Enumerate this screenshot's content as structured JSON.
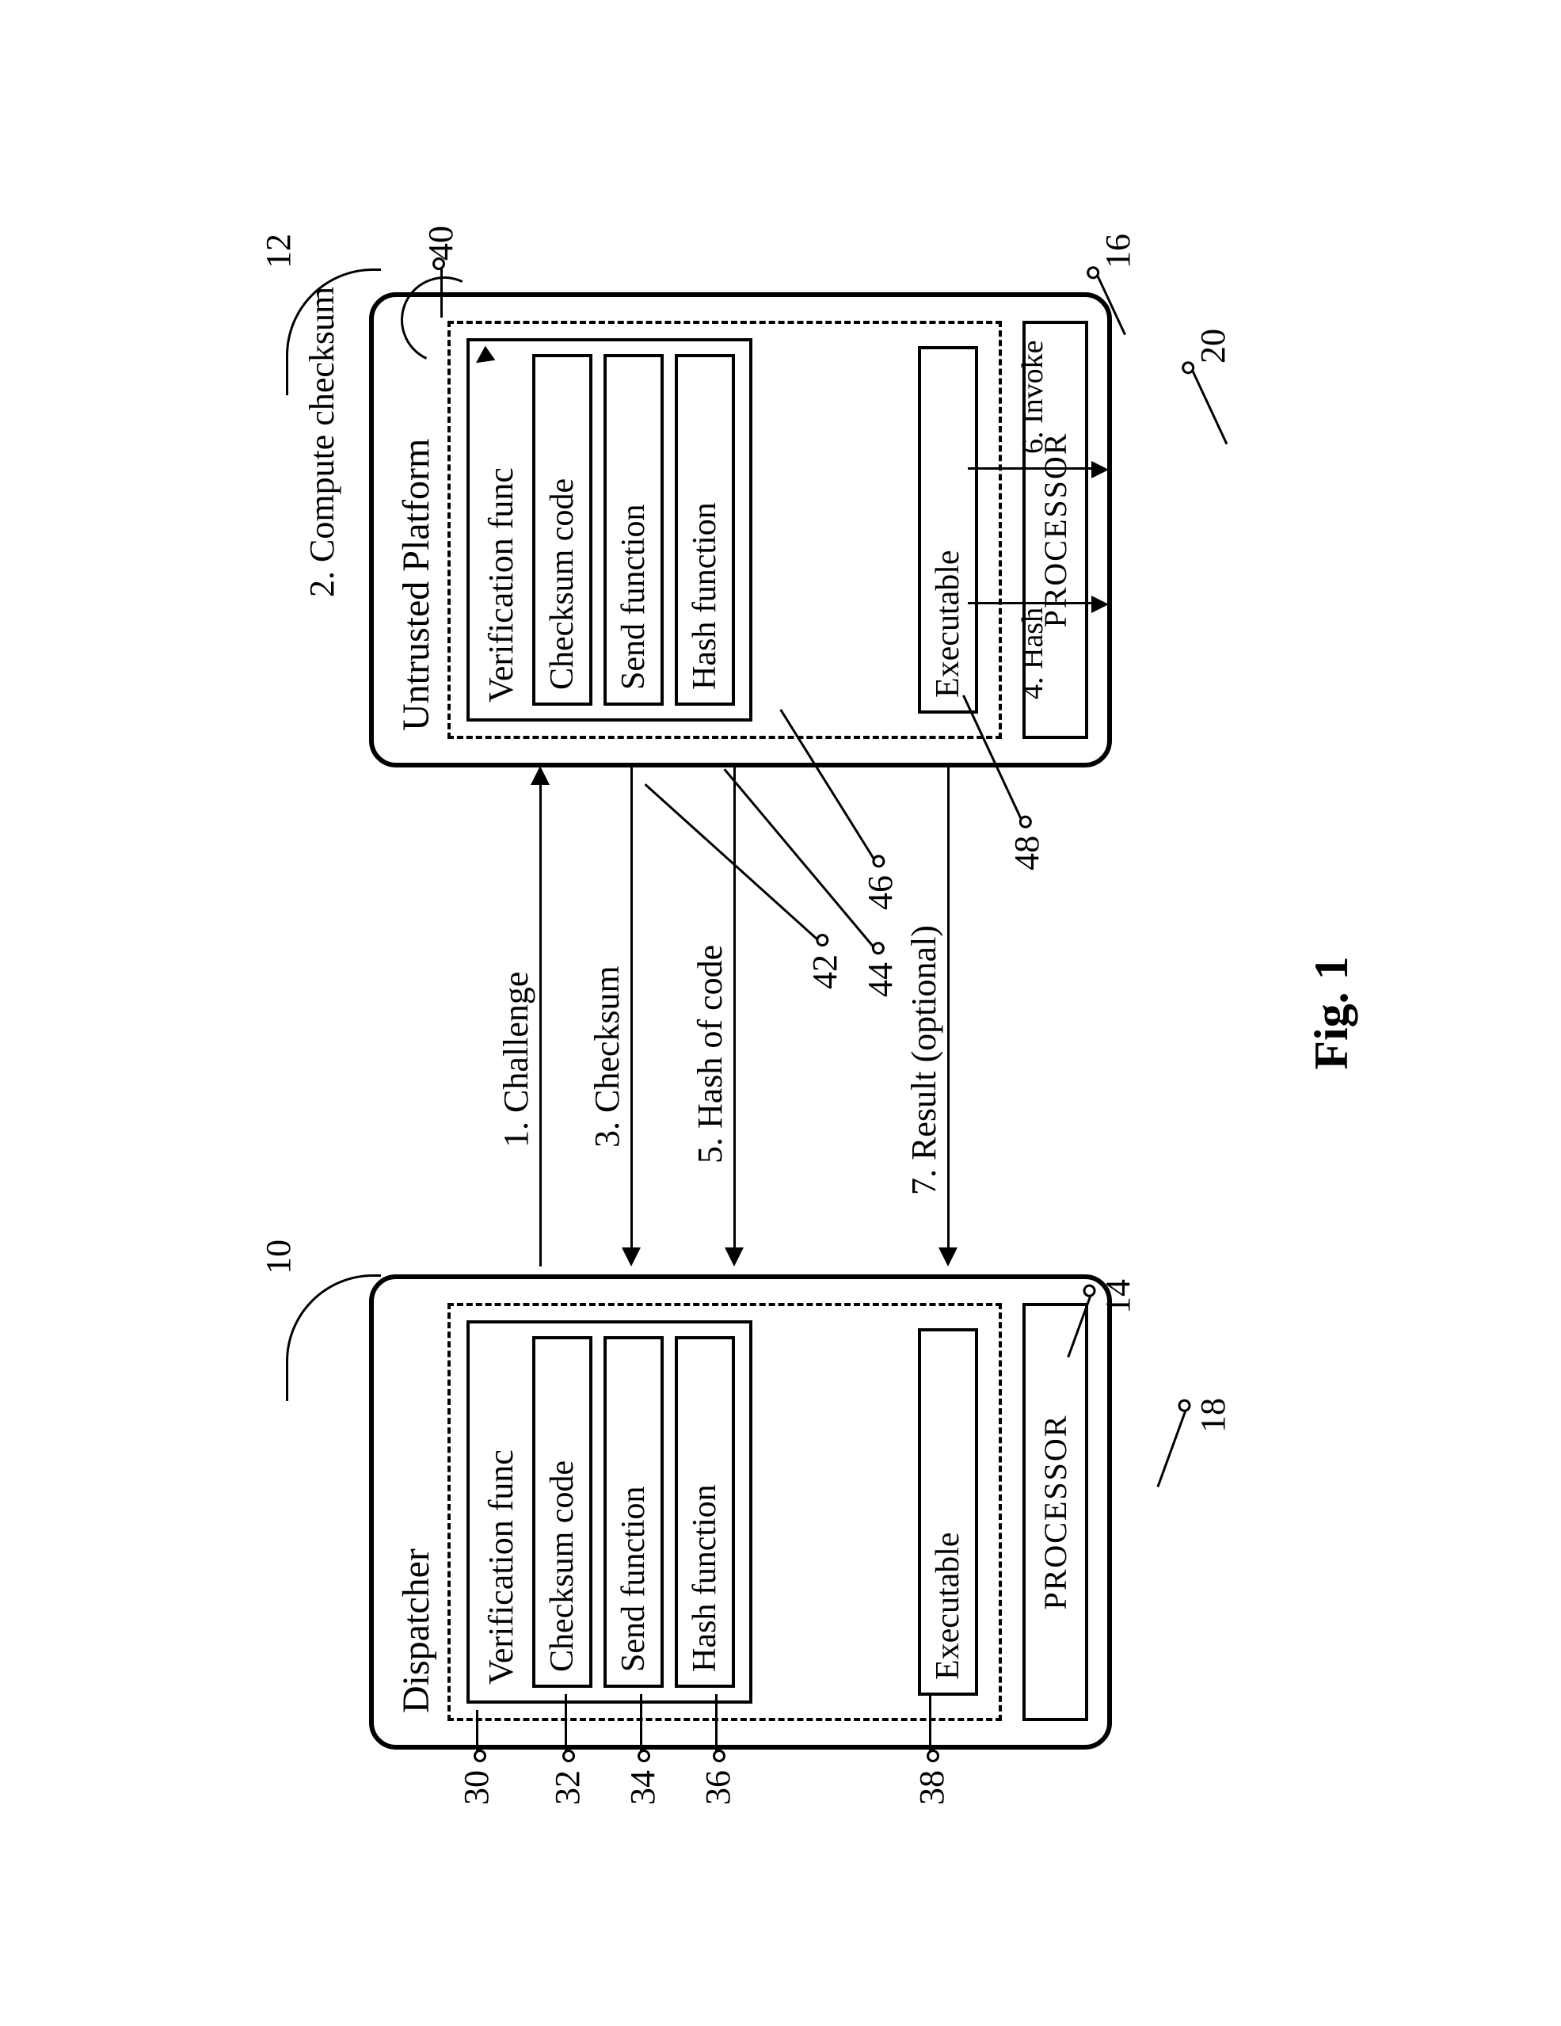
{
  "figure_label": "Fig. 1",
  "dispatcher": {
    "title": "Dispatcher",
    "vfunc": "Verification func",
    "checksum": "Checksum code",
    "send": "Send function",
    "hash": "Hash function",
    "exe": "Executable",
    "proc": "PROCESSOR"
  },
  "untrusted": {
    "title": "Untrusted Platform",
    "vfunc": "Verification func",
    "checksum": "Checksum code",
    "send": "Send function",
    "hash": "Hash function",
    "exe": "Executable",
    "proc": "PROCESSOR"
  },
  "messages": {
    "m1": "1. Challenge",
    "m2": "2. Compute checksum",
    "m3": "3. Checksum",
    "m4": "4. Hash",
    "m5": "5. Hash of code",
    "m6": "6. Invoke",
    "m7": "7. Result (optional)"
  },
  "refs": {
    "r10": "10",
    "r12": "12",
    "r14": "14",
    "r16": "16",
    "r18": "18",
    "r20": "20",
    "r30": "30",
    "r32": "32",
    "r34": "34",
    "r36": "36",
    "r38": "38",
    "r40": "40",
    "r42": "42",
    "r44": "44",
    "r46": "46",
    "r48": "48"
  }
}
